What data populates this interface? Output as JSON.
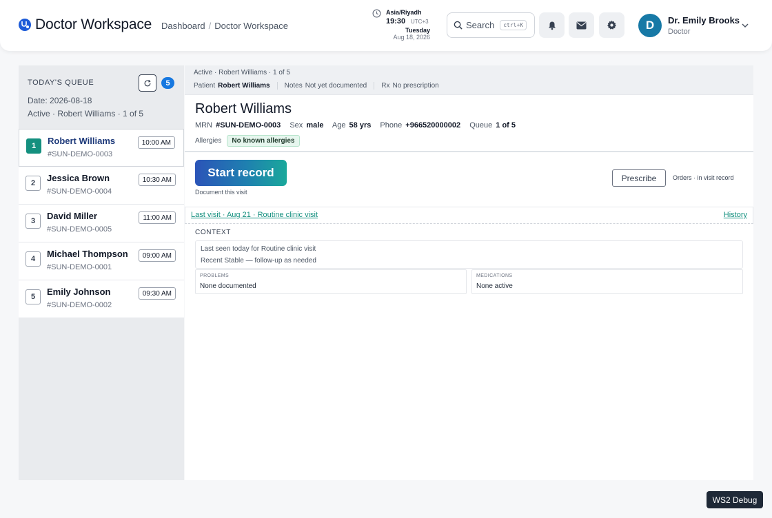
{
  "header": {
    "title": "Doctor Workspace",
    "breadcrumb": [
      "Dashboard",
      "Doctor Workspace"
    ],
    "breadcrumb_separator": "/",
    "clock": {
      "timezone": "Asia/Riyadh",
      "time": "19:30",
      "offset": "UTC+3",
      "day": "Tuesday",
      "date": "Aug 18, 2026"
    },
    "search": {
      "label": "Search",
      "shortcut": "ctrl+K"
    },
    "icons": [
      "bell-icon",
      "mail-icon",
      "gear-icon"
    ],
    "user": {
      "initial": "D",
      "name": "Dr. Emily Brooks",
      "role": "Doctor"
    }
  },
  "sidebar": {
    "title": "TODAY'S QUEUE",
    "count": "5",
    "date": "Date: 2026-08-18",
    "active": "Active · Robert Williams · 1 of 5",
    "queue": [
      {
        "num": "1",
        "name": "Robert Williams",
        "mrn": "#SUN-DEMO-0003",
        "time": "10:00 AM"
      },
      {
        "num": "2",
        "name": "Jessica Brown",
        "mrn": "#SUN-DEMO-0004",
        "time": "10:30 AM"
      },
      {
        "num": "3",
        "name": "David Miller",
        "mrn": "#SUN-DEMO-0005",
        "time": "11:00 AM"
      },
      {
        "num": "4",
        "name": "Michael Thompson",
        "mrn": "#SUN-DEMO-0001",
        "time": "09:00 AM"
      },
      {
        "num": "5",
        "name": "Emily Johnson",
        "mrn": "#SUN-DEMO-0002",
        "time": "09:30 AM"
      }
    ]
  },
  "main": {
    "context_bar": {
      "line1": "Active · Robert Williams · 1 of 5",
      "patient_label": "Patient",
      "patient_value": "Robert Williams",
      "notes_label": "Notes",
      "notes_value": "Not yet documented",
      "rx_label": "Rx",
      "rx_value": "No prescription"
    },
    "patient": {
      "name": "Robert Williams",
      "mrn_label": "MRN",
      "mrn": "#SUN-DEMO-0003",
      "sex_label": "Sex",
      "sex": "male",
      "age_label": "Age",
      "age": "58 yrs",
      "phone_label": "Phone",
      "phone": "+966520000002",
      "queue_label": "Queue",
      "queue": "1 of 5",
      "allergies_label": "Allergies",
      "allergies": "No known allergies"
    },
    "actions": {
      "start_record": "Start record",
      "start_sub": "Document this visit",
      "prescribe": "Prescribe",
      "orders_note": "Orders · in visit record"
    },
    "last_visit": {
      "link": "Last visit · Aug 21 · Routine clinic visit",
      "history": "History"
    },
    "context": {
      "title": "CONTEXT",
      "line1": "Last seen today for Routine clinic visit",
      "line2": "Recent Stable — follow-up as needed",
      "problems_label": "PROBLEMS",
      "problems_value": "None documented",
      "medications_label": "MEDICATIONS",
      "medications_value": "None active"
    }
  },
  "debug": {
    "label": "WS2 Debug"
  },
  "colors": {
    "accent_teal": "#14907f",
    "badge_blue": "#1778e0",
    "avatar_blue": "#1779a6",
    "brand_blue": "#1d5bd8"
  }
}
